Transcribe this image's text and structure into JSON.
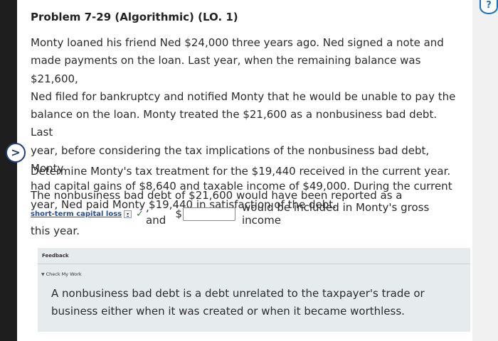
{
  "problem": {
    "title": "Problem 7-29 (Algorithmic) (LO. 1)",
    "lines": [
      "Monty loaned his friend Ned $24,000 three years ago. Ned signed a note and",
      "made payments on the loan. Last year, when the remaining balance was $21,600,",
      "Ned filed for bankruptcy and notified Monty that he would be unable to pay the",
      "balance on the loan. Monty treated the $21,600 as a nonbusiness bad debt. Last",
      "year, before considering the tax implications of the nonbusiness bad debt, Monty",
      "had capital gains of $8,640 and taxable income of $49,000. During the current",
      "year, Ned paid Monty $19,440 in satisfaction of the debt."
    ],
    "question": "Determine Monty's tax treatment for the $19,440 received in the current year."
  },
  "answer": {
    "sentence_start": "The nonbusiness bad debt of $21,600 would have been reported as a",
    "dropdown_selected": "short-term capital loss",
    "dropdown_arrow": "▾",
    "correct_mark": "✓",
    "and_text": ", and",
    "dollar": "$",
    "amount_value": "",
    "sentence_tail": "would be included in Monty's gross income",
    "sentence_end": "this year."
  },
  "feedback": {
    "label": "Feedback",
    "toggle_icon": "▼",
    "check_my_work": "Check My Work",
    "text": "A nonbusiness bad debt is a debt unrelated to the taxpayer's trade or business either when it was created or when it became worthless."
  },
  "controls": {
    "nav_arrow": ">",
    "help": "?"
  }
}
